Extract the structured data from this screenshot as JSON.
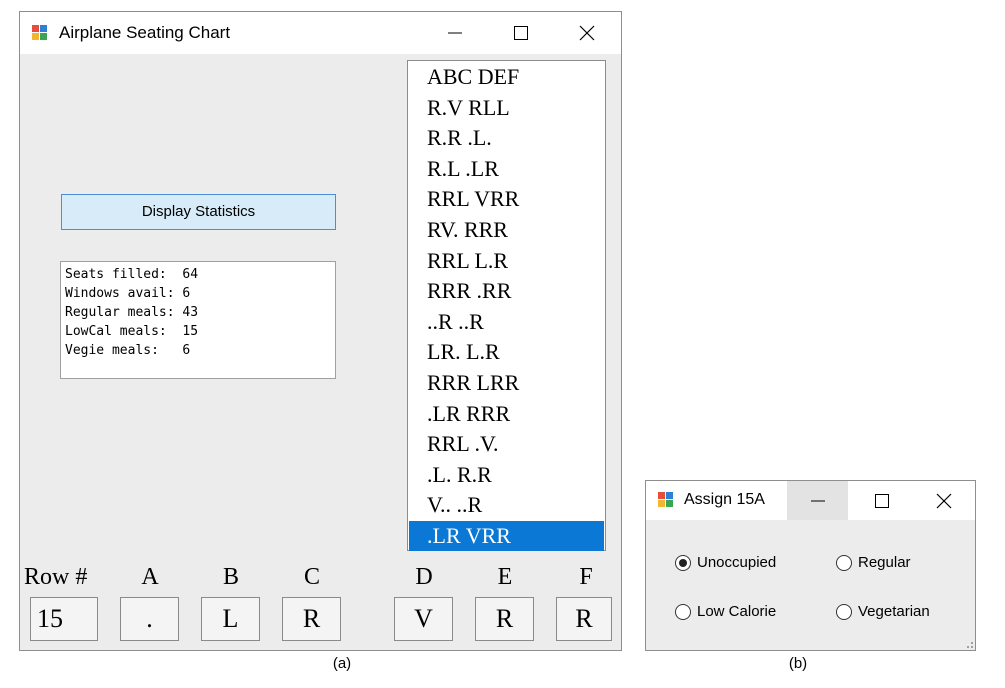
{
  "window_a": {
    "title": "Airplane Seating Chart",
    "display_stats_label": "Display Statistics",
    "stats": [
      "Seats filled:  64",
      "Windows avail: 6",
      "Regular meals: 43",
      "LowCal meals:  15",
      "Vegie meals:   6"
    ],
    "seat_rows": [
      "ABC DEF",
      "R.V RLL",
      "R.R .L.",
      "R.L .LR",
      "RRL VRR",
      "RV. RRR",
      "RRL L.R",
      "RRR .RR",
      "..R ..R",
      "LR. L.R",
      "RRR LRR",
      ".LR RRR",
      "RRL .V.",
      ".L. R.R",
      "V.. ..R",
      ".LR VRR"
    ],
    "selected_row_index": 15,
    "labels": {
      "row": "Row #",
      "a": "A",
      "b": "B",
      "c": "C",
      "d": "D",
      "e": "E",
      "f": "F"
    },
    "values": {
      "row": "15",
      "a": ".",
      "b": "L",
      "c": "R",
      "d": "V",
      "e": "R",
      "f": "R"
    }
  },
  "window_b": {
    "title": "Assign 15A",
    "options": {
      "unoccupied": "Unoccupied",
      "regular": "Regular",
      "low_calorie": "Low Calorie",
      "vegetarian": "Vegetarian"
    },
    "selected": "Unoccupied"
  },
  "captions": {
    "a": "(a)",
    "b": "(b)"
  },
  "colors": {
    "selection": "#0a78d4",
    "button_bg": "#d7ecf8",
    "window_bg": "#ececec"
  },
  "icons": [
    "app-icon",
    "minimize-icon",
    "maximize-icon",
    "close-icon",
    "resize-grip-icon"
  ]
}
